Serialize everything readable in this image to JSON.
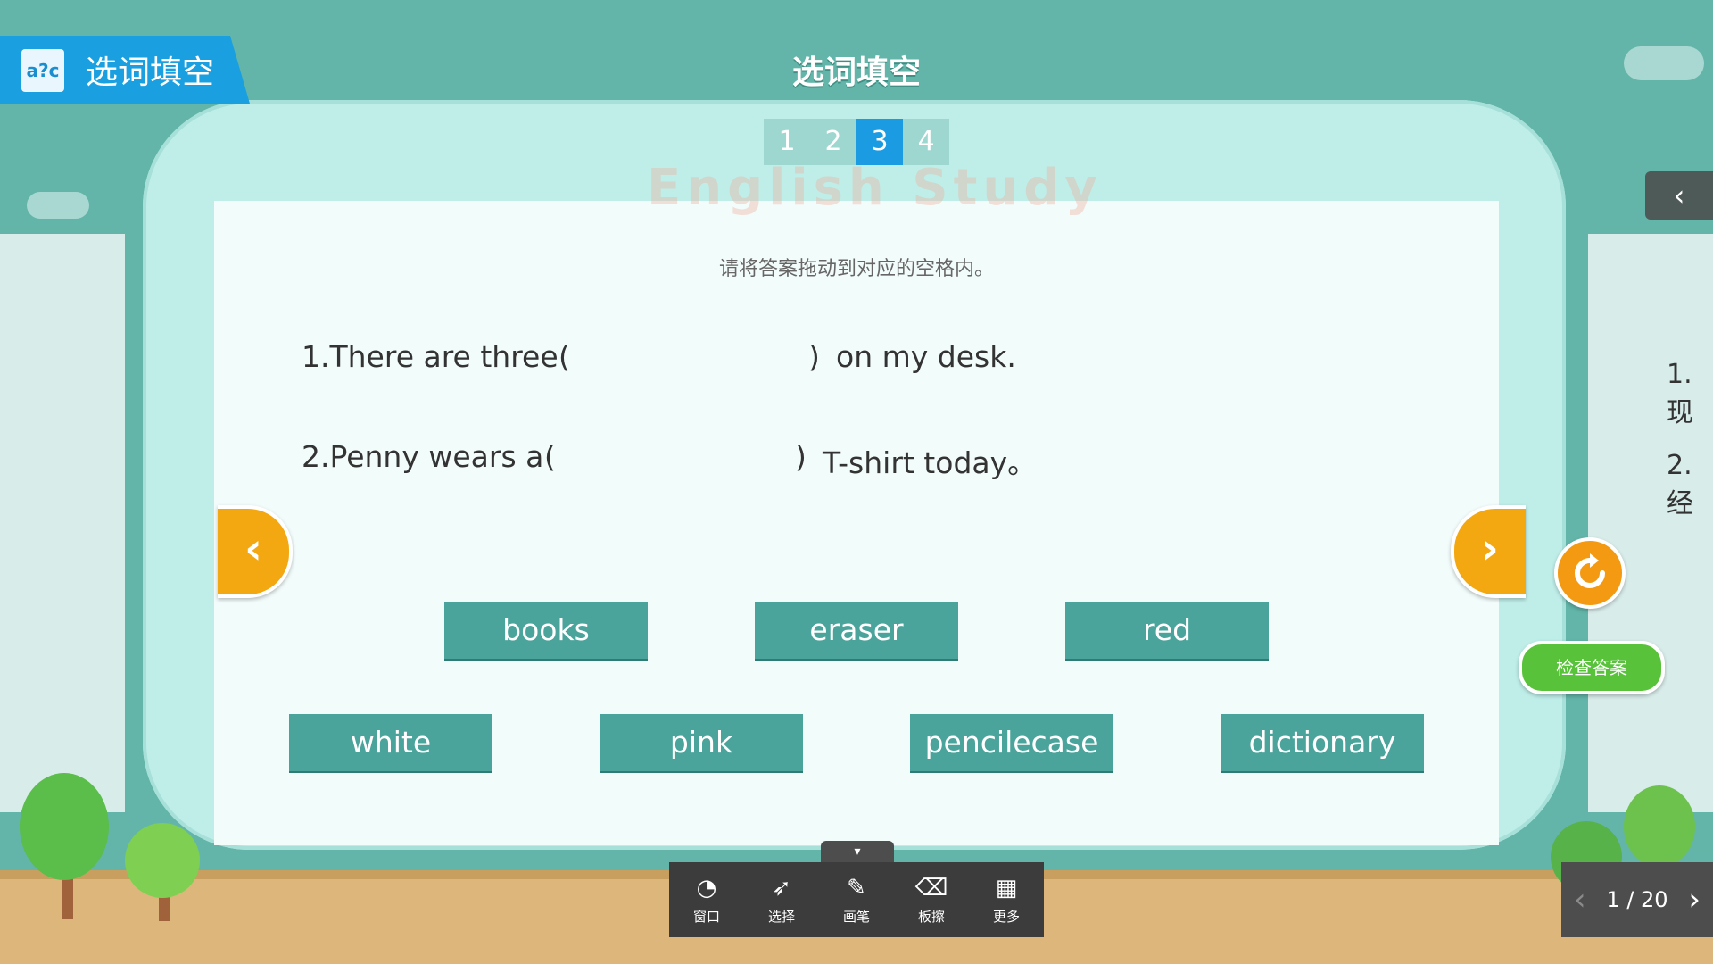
{
  "header": {
    "badge_icon_text": "a?c",
    "badge_title": "选词填空",
    "title": "选词填空"
  },
  "watermark": "English Study",
  "tabs": [
    {
      "label": "1",
      "active": false
    },
    {
      "label": "2",
      "active": false
    },
    {
      "label": "3",
      "active": true
    },
    {
      "label": "4",
      "active": false
    }
  ],
  "instruction": "请将答案拖动到对应的空格内。",
  "questions": [
    {
      "before": "1.There are three",
      "open": "(",
      "close": ")",
      "after": "on my desk."
    },
    {
      "before": "2.Penny wears a",
      "open": "(",
      "close": ")",
      "after": "T-shirt today。"
    }
  ],
  "word_bank": [
    "books",
    "eraser",
    "red",
    "white",
    "pink",
    "pencilecase",
    "dictionary"
  ],
  "right_panel": {
    "toggle": "‹",
    "peek_1": "1.现",
    "peek_2": "2.经",
    "refresh_icon": "refresh-icon",
    "check_label": "检查答案"
  },
  "nav": {
    "prev": "‹",
    "next": "›"
  },
  "toolbar": {
    "handle": "▾",
    "items": [
      {
        "icon": "◔",
        "label": "窗口"
      },
      {
        "icon": "➶",
        "label": "选择"
      },
      {
        "icon": "✎",
        "label": "画笔"
      },
      {
        "icon": "⌫",
        "label": "板擦"
      },
      {
        "icon": "▦",
        "label": "更多"
      }
    ]
  },
  "pager": {
    "prev": "‹",
    "text": "1 / 20",
    "next": "›"
  },
  "colors": {
    "sky": "#63b5a9",
    "frame": "#bfeee9",
    "word_tile": "#4aa49b",
    "tab_active": "#1a9be2",
    "accent_orange": "#f3a812",
    "check_green": "#58c23a"
  }
}
